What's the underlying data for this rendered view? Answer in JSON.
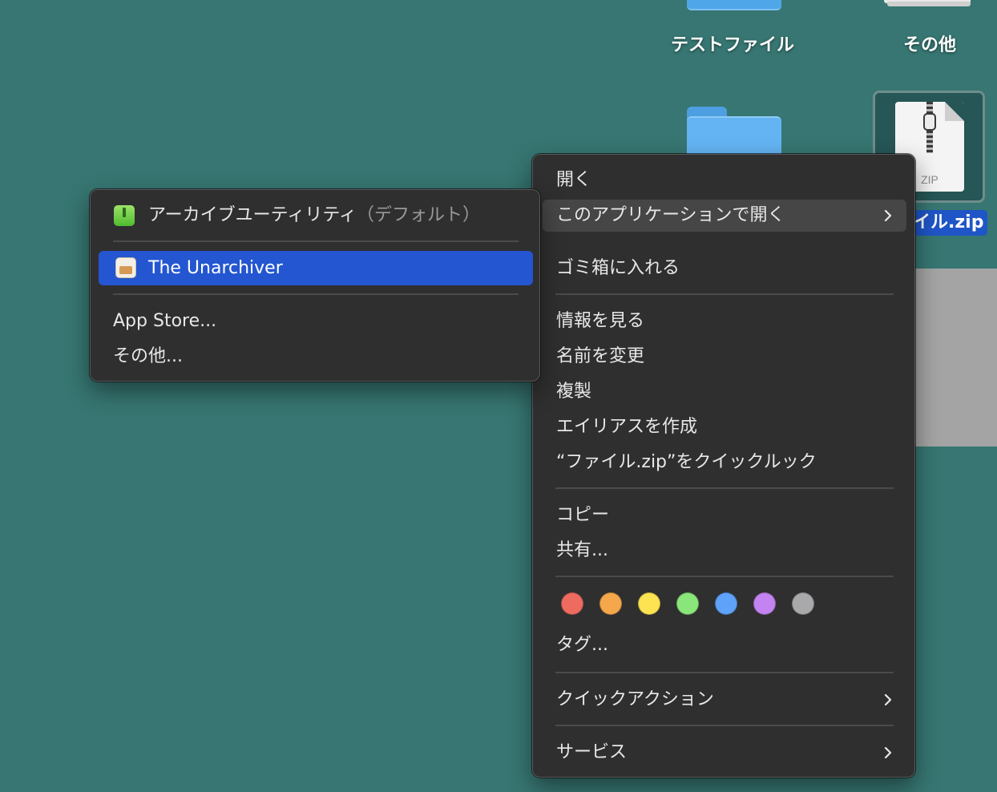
{
  "desktop": {
    "labels": [
      "テストファイル",
      "その他"
    ],
    "zip_file": {
      "icon_text": "ZIP",
      "name_visible": "イル.zip"
    }
  },
  "context_menu": {
    "items": [
      {
        "label": "開く"
      },
      {
        "label": "このアプリケーションで開く",
        "has_submenu": true,
        "active": true
      },
      {
        "label": "ゴミ箱に入れる"
      },
      {
        "label": "情報を見る"
      },
      {
        "label": "名前を変更"
      },
      {
        "label": "複製"
      },
      {
        "label": "エイリアスを作成"
      },
      {
        "label": "“ファイル.zip”をクイックルック"
      },
      {
        "label": "コピー"
      },
      {
        "label": "共有..."
      },
      {
        "label": "タグ..."
      },
      {
        "label": "クイックアクション",
        "has_submenu": true
      },
      {
        "label": "サービス",
        "has_submenu": true
      }
    ],
    "tag_colors": [
      {
        "name": "red",
        "color": "#ee6b60"
      },
      {
        "name": "orange",
        "color": "#f5a74b"
      },
      {
        "name": "yellow",
        "color": "#fde352"
      },
      {
        "name": "green",
        "color": "#8ae67a"
      },
      {
        "name": "blue",
        "color": "#5fa2f9"
      },
      {
        "name": "purple",
        "color": "#c383f0"
      },
      {
        "name": "gray",
        "color": "#a9a9ab"
      }
    ]
  },
  "open_with_submenu": {
    "items": [
      {
        "label": "アーカイブユーティリティ",
        "note": "（デフォルト）",
        "icon": "archive-utility-icon"
      },
      {
        "label": "The Unarchiver",
        "icon": "the-unarchiver-icon",
        "selected": true
      },
      {
        "label": "App Store..."
      },
      {
        "label": "その他..."
      }
    ]
  },
  "colors": {
    "desktop_background": "#377672",
    "menu_background": "#2f2f2f",
    "selection": "#2356d0"
  }
}
